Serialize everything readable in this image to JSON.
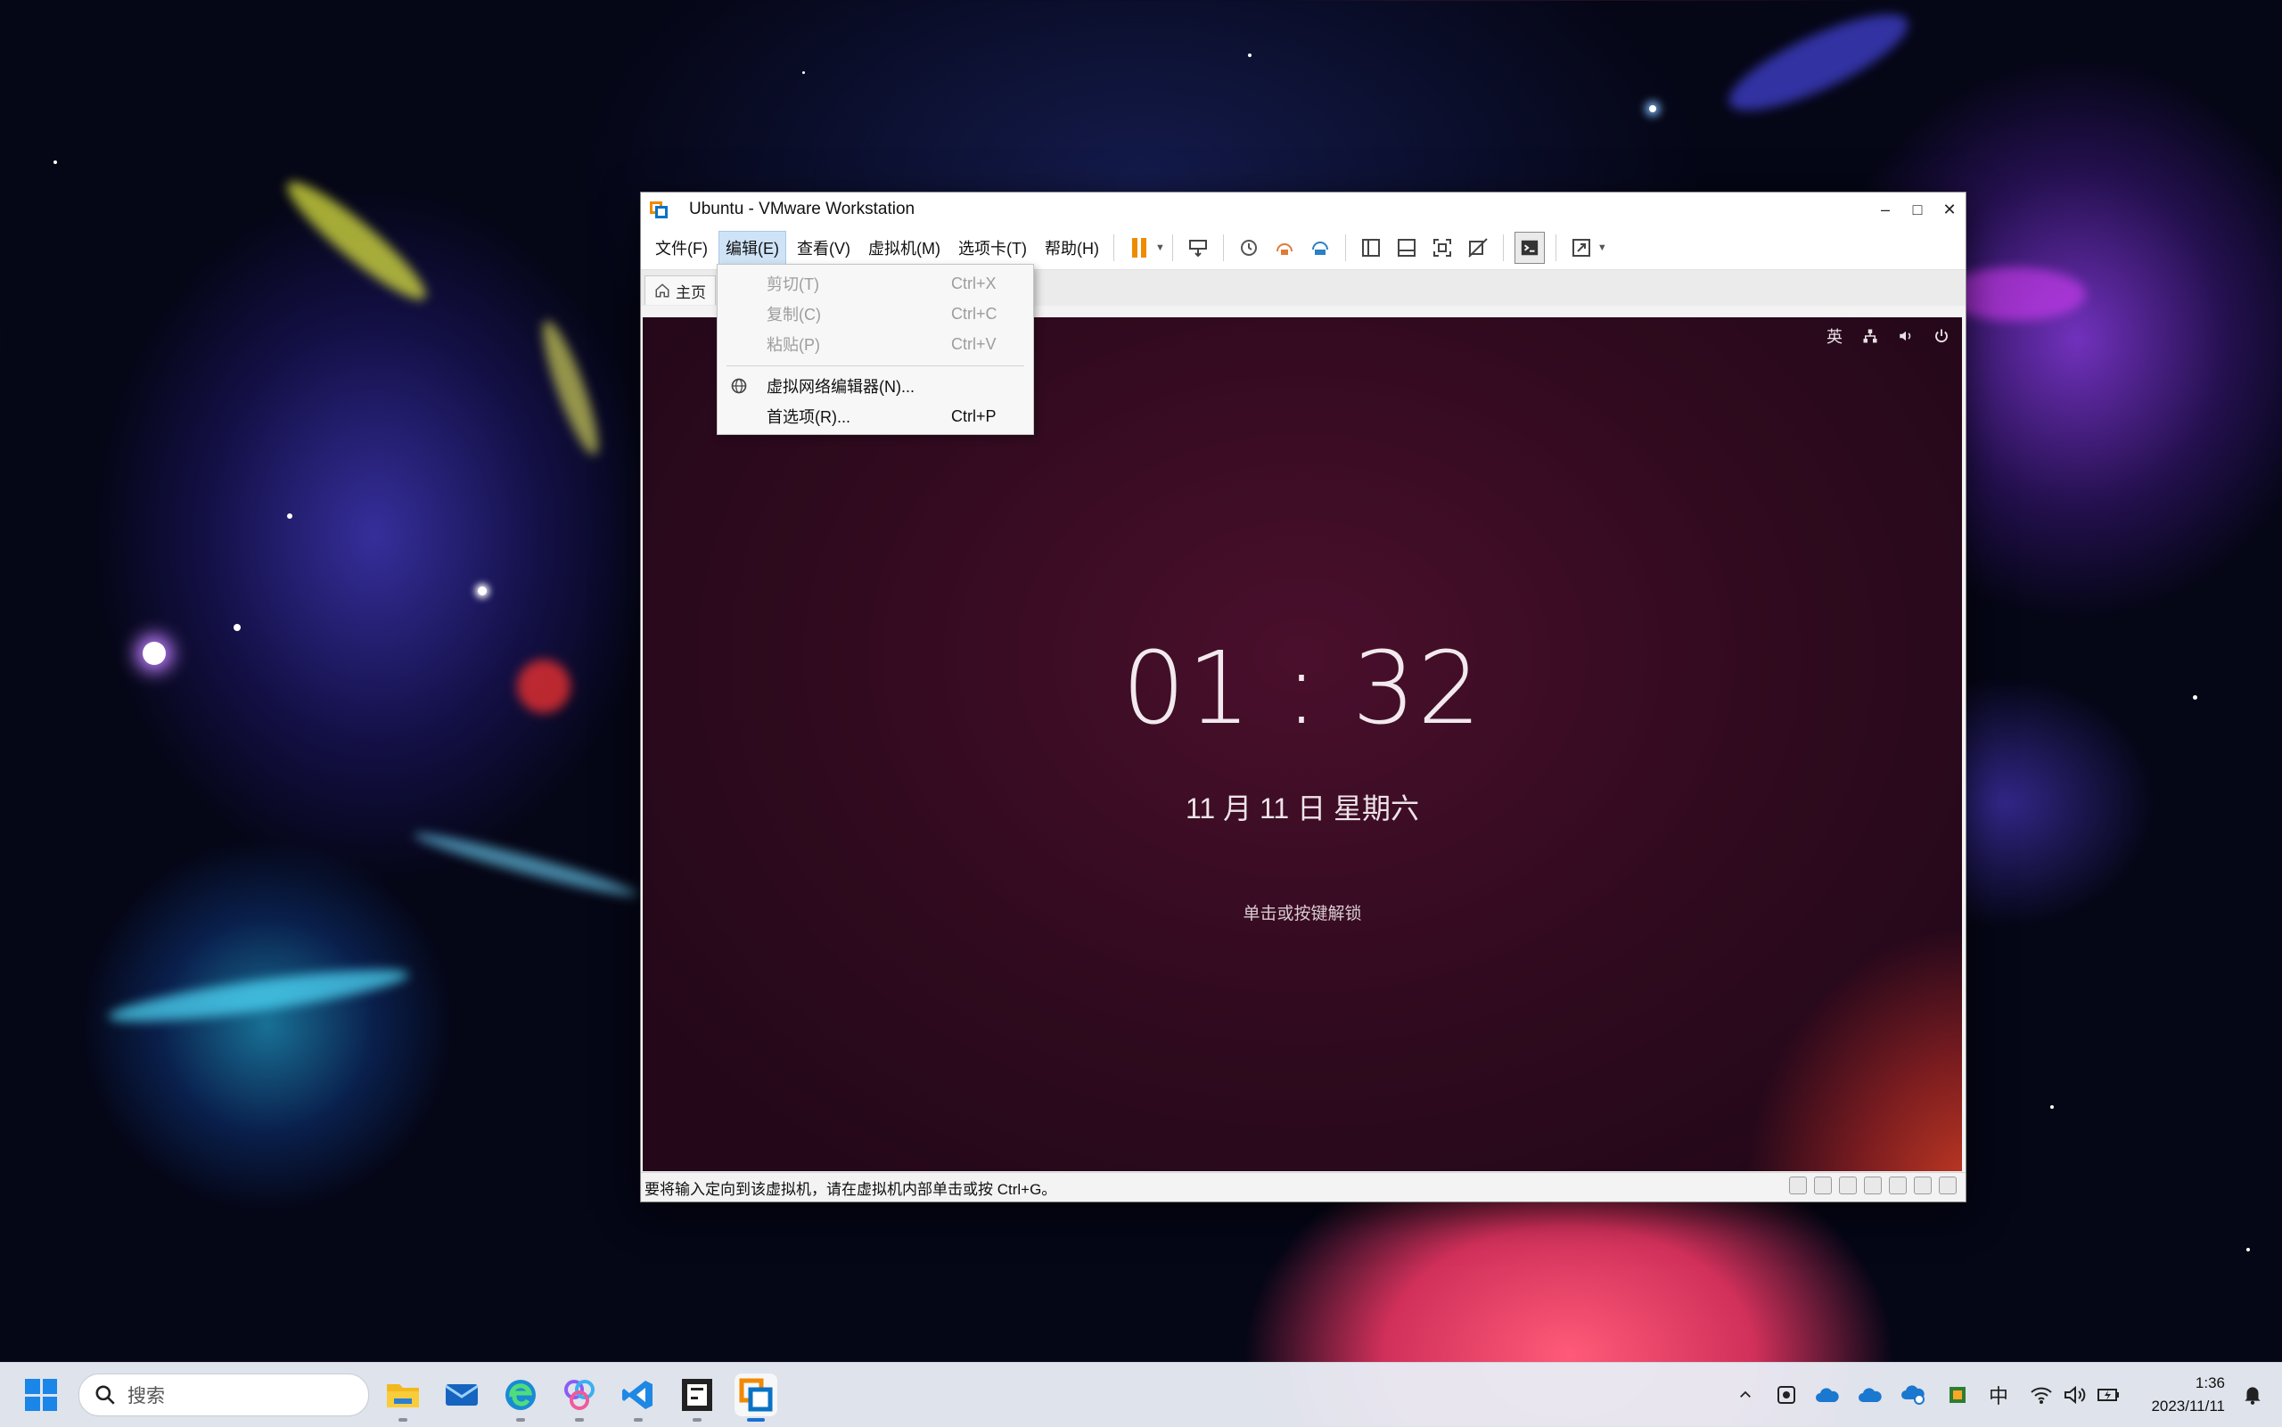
{
  "window": {
    "title": "Ubuntu - VMware Workstation",
    "controls": {
      "minimize": "–",
      "maximize": "□",
      "close": "✕"
    }
  },
  "menubar": {
    "items": [
      {
        "label": "文件(F)"
      },
      {
        "label": "编辑(E)"
      },
      {
        "label": "查看(V)"
      },
      {
        "label": "虚拟机(M)"
      },
      {
        "label": "选项卡(T)"
      },
      {
        "label": "帮助(H)"
      }
    ]
  },
  "tabs": {
    "home_label": "主页"
  },
  "edit_menu": {
    "items": [
      {
        "label": "剪切(T)",
        "shortcut": "Ctrl+X"
      },
      {
        "label": "复制(C)",
        "shortcut": "Ctrl+C"
      },
      {
        "label": "粘贴(P)",
        "shortcut": "Ctrl+V"
      },
      {
        "label": "虚拟网络编辑器(N)...",
        "shortcut": ""
      },
      {
        "label": "首选项(R)...",
        "shortcut": "Ctrl+P"
      }
    ]
  },
  "guest": {
    "input_indicator": "英",
    "clock_hour": "01",
    "clock_sep": ":",
    "clock_minute": "32",
    "date": "11 月 11 日 星期六",
    "unlock_hint": "单击或按键解锁"
  },
  "statusbar": {
    "text": "要将输入定向到该虚拟机，请在虚拟机内部单击或按 Ctrl+G。"
  },
  "taskbar": {
    "search_placeholder": "搜索",
    "tray_ime": "中",
    "time": "1:36",
    "date": "2023/11/11"
  },
  "colors": {
    "accent_orange": "#f08a00",
    "vmware_blue": "#0a72c4",
    "menu_highlight": "#cfe3f7",
    "guest_bg": "#300a1e",
    "windows_blue": "#1a86e8"
  }
}
